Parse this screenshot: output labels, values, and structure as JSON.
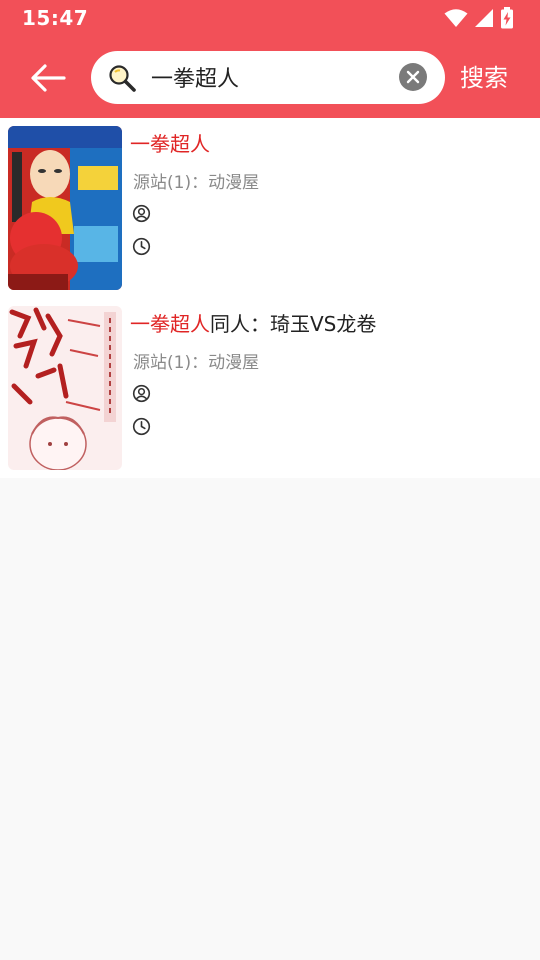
{
  "status_bar": {
    "time": "15:47",
    "icons": [
      "wifi-icon",
      "signal-icon",
      "battery-charging-icon"
    ]
  },
  "header": {
    "back_icon": "arrow-left-icon",
    "search": {
      "value": "一拳超人",
      "icon": "magnifier-icon",
      "clear_icon": "close-icon"
    },
    "search_button_label": "搜索"
  },
  "colors": {
    "accent": "#f25058",
    "highlight": "#e02525",
    "secondary_text": "#8a8a8a"
  },
  "results": [
    {
      "title_highlight": "一拳超人",
      "title_rest": "",
      "source": "源站(1)：动漫屋",
      "author_icon": "person-icon",
      "time_icon": "clock-icon"
    },
    {
      "title_highlight": "一拳超人",
      "title_rest": "同人：琦玉VS龙卷",
      "source": "源站(1)：动漫屋",
      "author_icon": "person-icon",
      "time_icon": "clock-icon"
    }
  ]
}
